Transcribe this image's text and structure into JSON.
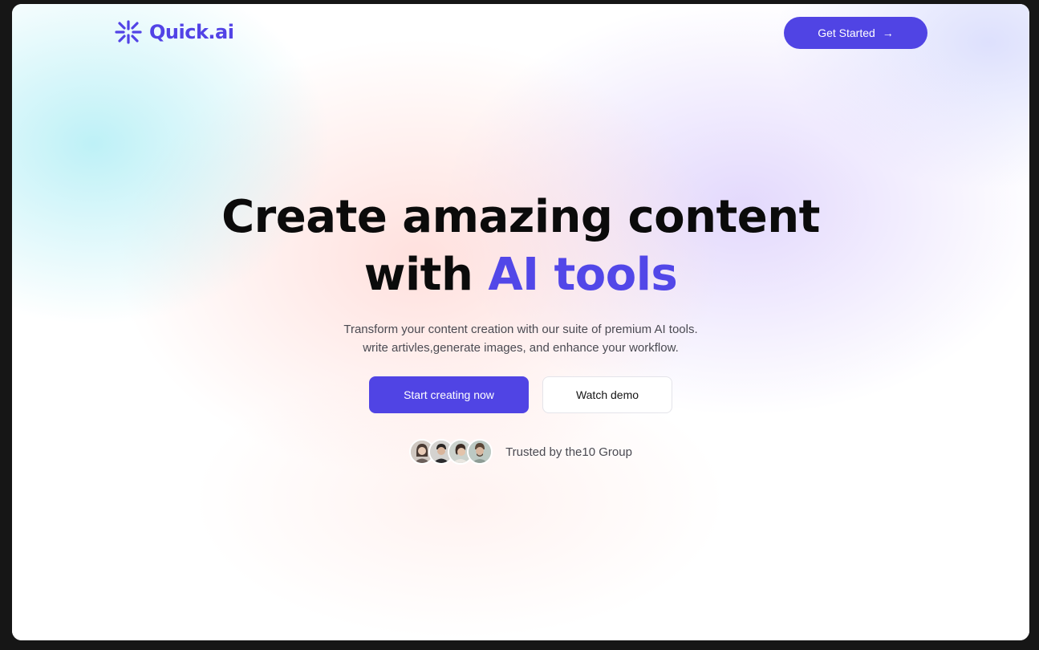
{
  "nav": {
    "logo_text": "Quick.ai",
    "logo_icon": "sparkle-star-icon",
    "cta_label": "Get Started",
    "cta_icon": "→"
  },
  "hero": {
    "headline_line1": "Create amazing content",
    "headline_line2_prefix": "with ",
    "headline_accent": "AI tools",
    "subtitle_line1": "Transform your content creation with our suite of premium AI tools.",
    "subtitle_line2": "write artivles,generate images, and enhance your workflow.",
    "primary_button": "Start creating now",
    "secondary_button": "Watch demo",
    "trust_text": "Trusted by the10 Group"
  },
  "colors": {
    "brand": "#5044e4",
    "accent_text": "#5247e8",
    "headline": "#0b0b0b",
    "body_text": "#4a4a52"
  }
}
